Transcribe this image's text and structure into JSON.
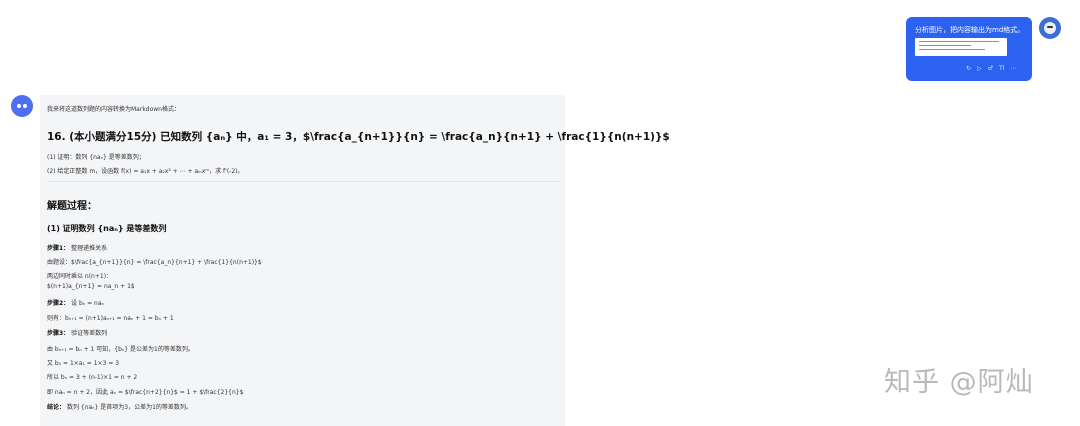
{
  "user_message": {
    "text": "分析图片，把内容输出为md格式。",
    "tools": [
      "↻",
      "▷",
      "♂",
      "Tl",
      "⋯"
    ]
  },
  "answer": {
    "intro": "我来将这道数列题的内容转换为Markdown格式：",
    "problem_title": "16. (本小题满分15分) 已知数列 {aₙ} 中，a₁ = 3，$\\frac{a_{n+1}}{n} = \\frac{a_n}{n+1} + \\frac{1}{n(n+1)}$",
    "q1": "(1) 证明：数列 {naₙ} 是等差数列；",
    "q2": "(2) 给定正整数 m，设函数 f(x) = a₁x + a₂x² + ⋯ + aₘxᵐ，求 f'(-2)。",
    "section_title": "解题过程：",
    "part1_title": "(1) 证明数列 {naₙ} 是等差数列",
    "step1_label": "步骤1：",
    "step1_text": "整理递推关系",
    "l1": "由题设：$\\frac{a_{n+1}}{n} = \\frac{a_n}{n+1} + \\frac{1}{n(n+1)}$",
    "l2": "两边同时乘以 n(n+1)：",
    "l3": "$(n+1)a_{n+1} = na_n + 1$",
    "step2_label": "步骤2：",
    "step2_text": "设 bₙ = naₙ",
    "l4": "则有：bₙ₊₁ = (n+1)aₙ₊₁ = naₙ + 1 = bₙ + 1",
    "step3_label": "步骤3：",
    "step3_text": "验证等差数列",
    "l5": "由 bₙ₊₁ = bₙ + 1 可知，{bₙ} 是公差为1的等差数列。",
    "l6": "又 b₁ = 1×a₁ = 1×3 = 3",
    "l7": "所以 bₙ = 3 + (n-1)×1 = n + 2",
    "l8": "即 naₙ = n + 2，因此 aₙ = $\\frac{n+2}{n}$ = 1 + $\\frac{2}{n}$",
    "conclusion_label": "结论：",
    "conclusion_text": "数列 {naₙ} 是首项为3，公差为1的等差数列。"
  },
  "watermark": "知乎 @阿灿"
}
